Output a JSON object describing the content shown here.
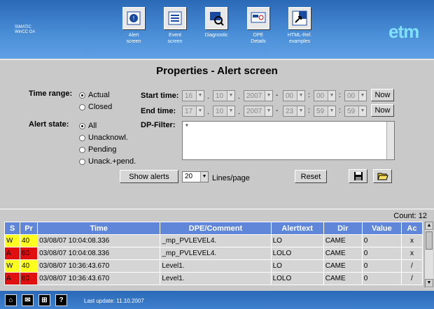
{
  "brand": {
    "line1": "SIMATIC",
    "line2": "WinCC OA"
  },
  "logo": "etm",
  "nav": [
    {
      "line1": "Alert",
      "line2": "screen",
      "icon": "alert-screen-icon"
    },
    {
      "line1": "Event",
      "line2": "screen",
      "icon": "event-screen-icon"
    },
    {
      "line1": "Diagnostic",
      "line2": "",
      "icon": "diagnostic-icon"
    },
    {
      "line1": "DPE",
      "line2": "Details",
      "icon": "dpe-details-icon"
    },
    {
      "line1": "HTML-Ref.",
      "line2": "examples",
      "icon": "html-ref-icon"
    }
  ],
  "title": "Properties - Alert screen",
  "time_range": {
    "label": "Time range:",
    "options": [
      "Actual",
      "Closed"
    ],
    "selected": "Actual"
  },
  "alert_state": {
    "label": "Alert state:",
    "options": [
      "All",
      "Unacknowl.",
      "Pending",
      "Unack.+pend."
    ],
    "selected": "All"
  },
  "start_time": {
    "label": "Start time:",
    "day": "16",
    "month": "10",
    "year": "2007",
    "hour": "00",
    "minute": "00",
    "second": "00"
  },
  "end_time": {
    "label": "End time:",
    "day": "17",
    "month": "10",
    "year": "2007",
    "hour": "23",
    "minute": "59",
    "second": "59"
  },
  "now_label": "Now",
  "dp_filter": {
    "label": "DP-Filter:",
    "value": "*"
  },
  "show_alerts_label": "Show alerts",
  "lines_per_page": {
    "value": "20",
    "label": "Lines/page"
  },
  "reset_label": "Reset",
  "count_label": "Count: 12",
  "table": {
    "headers": [
      "S",
      "Pr",
      "Time",
      "DPE/Comment",
      "Alerttext",
      "Dir",
      "Value",
      "Ac"
    ],
    "rows": [
      {
        "s": "W",
        "pr": "40",
        "time": "03/08/07 10:04:08.336",
        "dpe": "_mp_PVLEVEL4.",
        "text": "LO",
        "dir": "CAME",
        "value": "0",
        "ac": "x",
        "level": "w"
      },
      {
        "s": "A",
        "pr": "60",
        "time": "03/08/07 10:04:08.336",
        "dpe": "_mp_PVLEVEL4.",
        "text": "LOLO",
        "dir": "CAME",
        "value": "0",
        "ac": "x",
        "level": "a"
      },
      {
        "s": "W",
        "pr": "40",
        "time": "03/08/07 10:36:43.670",
        "dpe": "Level1.",
        "text": "LO",
        "dir": "CAME",
        "value": "0",
        "ac": "/",
        "level": "w"
      },
      {
        "s": "A",
        "pr": "60",
        "time": "03/08/07 10:36:43.670",
        "dpe": "Level1.",
        "text": "LOLO",
        "dir": "CAME",
        "value": "0",
        "ac": "/",
        "level": "a"
      }
    ]
  },
  "footer": {
    "last_update": "Last update: 11.10.2007"
  },
  "colors": {
    "header": "#2b69b7",
    "table_header": "#5f86d8",
    "warning": "#ffff20",
    "alarm": "#e01010"
  }
}
